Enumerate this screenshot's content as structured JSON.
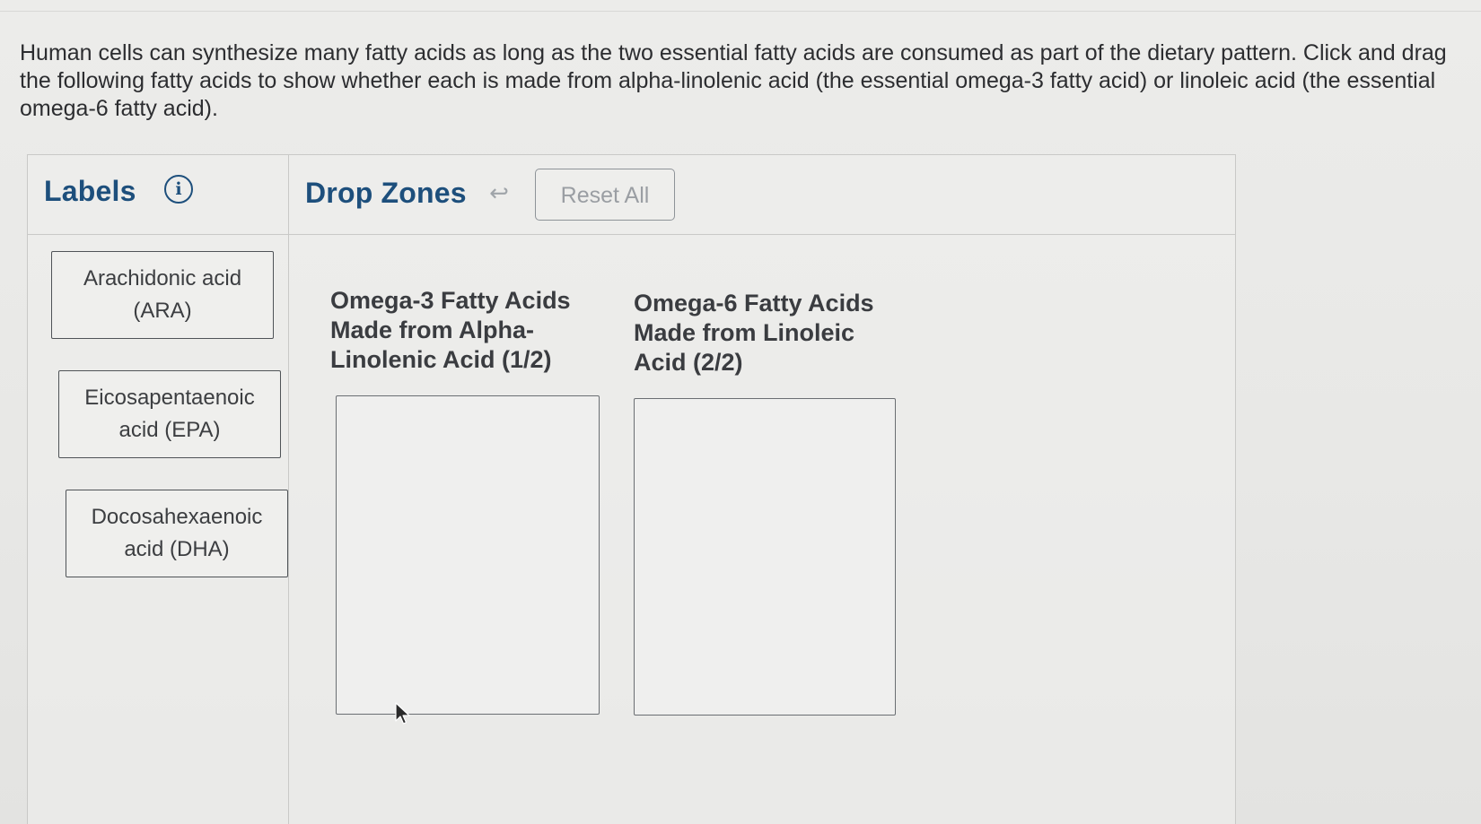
{
  "question": {
    "text": "Human cells can synthesize many fatty acids as long as the two essential fatty acids are consumed as part of the dietary pattern. Click and drag the following fatty acids to show whether each is made from alpha-linolenic acid (the essential omega-3 fatty acid) or linoleic acid (the essential omega-6 fatty acid)."
  },
  "labels_panel": {
    "title": "Labels",
    "info_icon": "i",
    "items": [
      {
        "label": "Arachidonic acid (ARA)"
      },
      {
        "label": "Eicosapentaenoic acid (EPA)"
      },
      {
        "label": "Docosahexaenoic acid (DHA)"
      }
    ]
  },
  "drop_zones_panel": {
    "title": "Drop Zones",
    "undo_icon": "↩",
    "reset_label": "Reset All",
    "zones": [
      {
        "heading": "Omega-3 Fatty Acids Made from Alpha-Linolenic Acid (1/2)"
      },
      {
        "heading": "Omega-6 Fatty Acids Made from Linoleic Acid (2/2)"
      }
    ]
  },
  "colors": {
    "accent": "#1d4f7c",
    "text": "#2c2d30",
    "border": "#4f5357",
    "background": "#e9e9e7"
  }
}
